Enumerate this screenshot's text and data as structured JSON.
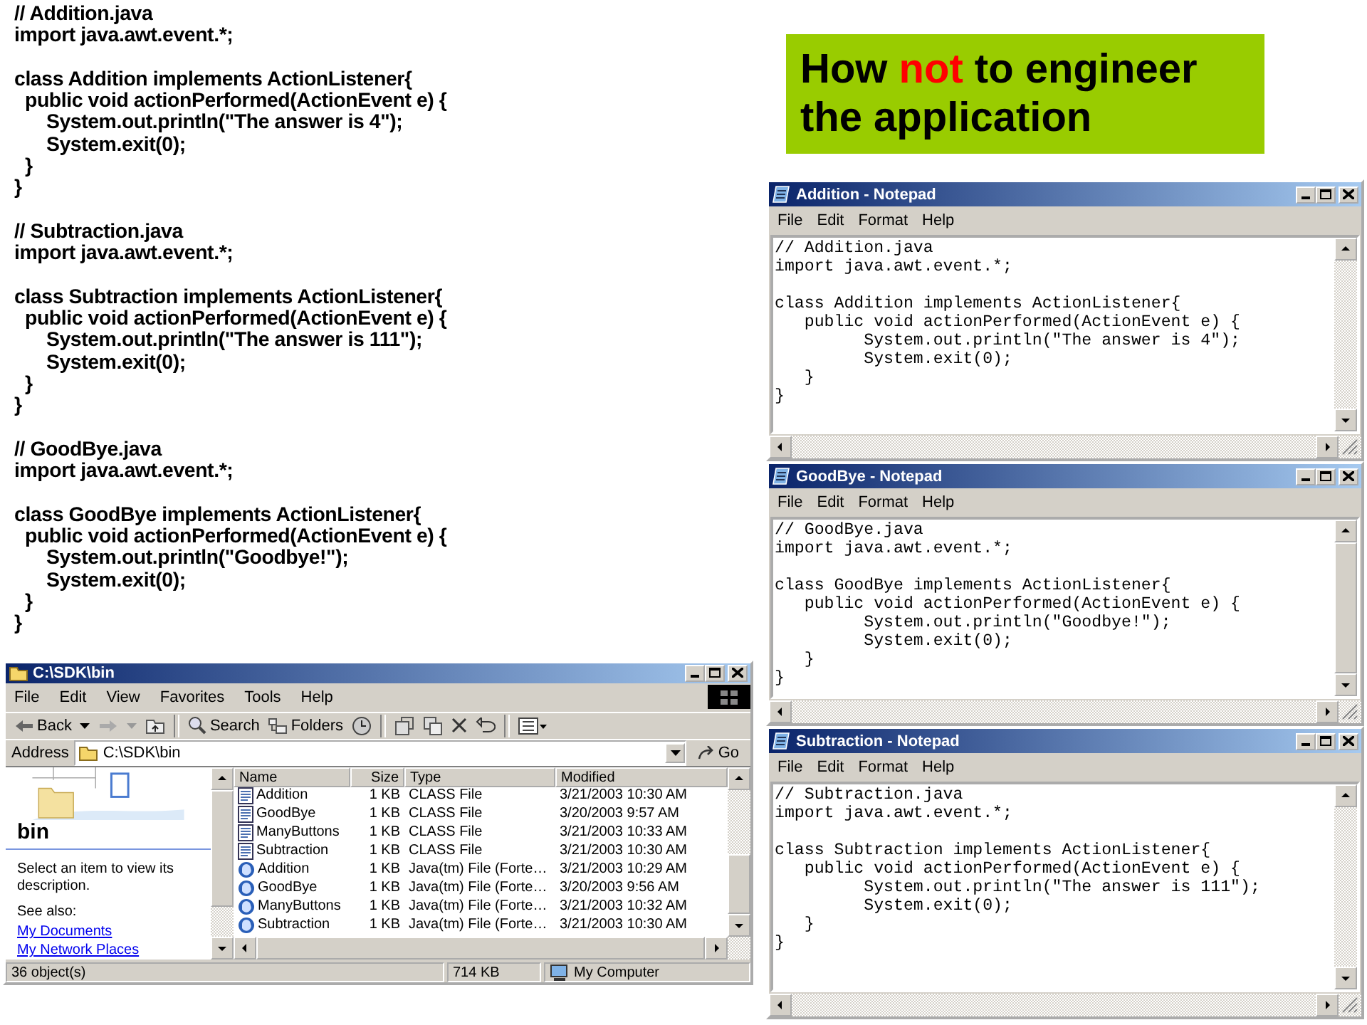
{
  "code_listing": {
    "files": [
      {
        "blocks": [
          [
            "// Addition.java",
            "import java.awt.event.*;"
          ],
          [
            "class Addition implements ActionListener{",
            "  public void actionPerformed(ActionEvent e) {",
            "      System.out.println(\"The answer is 4\");",
            "      System.exit(0);",
            "  }",
            "}"
          ]
        ]
      },
      {
        "blocks": [
          [
            "// Subtraction.java",
            "import java.awt.event.*;"
          ],
          [
            "class Subtraction implements ActionListener{",
            "  public void actionPerformed(ActionEvent e) {",
            "      System.out.println(\"The answer is 111\");",
            "      System.exit(0);",
            "  }",
            "}"
          ]
        ]
      },
      {
        "blocks": [
          [
            "// GoodBye.java",
            "import java.awt.event.*;"
          ],
          [
            "class GoodBye implements ActionListener{",
            "  public void actionPerformed(ActionEvent e) {",
            "      System.out.println(\"Goodbye!\");",
            "      System.exit(0);",
            "  }",
            "}"
          ]
        ]
      }
    ]
  },
  "headline": {
    "parts": [
      {
        "text": "How ",
        "emphasis": false
      },
      {
        "text": "not",
        "emphasis": true
      },
      {
        "text": " to engineer the application",
        "emphasis": false
      }
    ]
  },
  "explorer": {
    "title": "C:\\SDK\\bin",
    "menu": [
      "File",
      "Edit",
      "View",
      "Favorites",
      "Tools",
      "Help"
    ],
    "toolbar": {
      "back": "Back",
      "search": "Search",
      "folders": "Folders"
    },
    "address": {
      "label": "Address",
      "value": "C:\\SDK\\bin",
      "go": "Go"
    },
    "side_panel": {
      "folder": "bin",
      "description": "Select an item to view its description.",
      "see_also": "See also:",
      "links": [
        "My Documents",
        "My Network Places"
      ]
    },
    "columns": [
      "Name",
      "Size",
      "Type",
      "Modified"
    ],
    "rows": [
      {
        "kind": "class",
        "name": "Addition",
        "size": "1 KB",
        "type": "CLASS File",
        "modified": "3/21/2003 10:30 AM"
      },
      {
        "kind": "class",
        "name": "GoodBye",
        "size": "1 KB",
        "type": "CLASS File",
        "modified": "3/20/2003 9:57 AM"
      },
      {
        "kind": "class",
        "name": "ManyButtons",
        "size": "1 KB",
        "type": "CLASS File",
        "modified": "3/21/2003 10:33 AM"
      },
      {
        "kind": "class",
        "name": "Subtraction",
        "size": "1 KB",
        "type": "CLASS File",
        "modified": "3/21/2003 10:30 AM"
      },
      {
        "kind": "java",
        "name": "Addition",
        "size": "1 KB",
        "type": "Java(tm) File (Forte…",
        "modified": "3/21/2003 10:29 AM"
      },
      {
        "kind": "java",
        "name": "GoodBye",
        "size": "1 KB",
        "type": "Java(tm) File (Forte…",
        "modified": "3/20/2003 9:56 AM"
      },
      {
        "kind": "java",
        "name": "ManyButtons",
        "size": "1 KB",
        "type": "Java(tm) File (Forte…",
        "modified": "3/21/2003 10:32 AM"
      },
      {
        "kind": "java",
        "name": "Subtraction",
        "size": "1 KB",
        "type": "Java(tm) File (Forte…",
        "modified": "3/21/2003 10:30 AM"
      }
    ],
    "status_bar": {
      "objects": "36 object(s)",
      "size": "714 KB",
      "zone": "My Computer"
    }
  },
  "notepads": [
    {
      "title": "Addition - Notepad",
      "menu": [
        "File",
        "Edit",
        "Format",
        "Help"
      ],
      "blocks": [
        [
          "// Addition.java",
          "import java.awt.event.*;"
        ],
        [
          "class Addition implements ActionListener{",
          "   public void actionPerformed(ActionEvent e) {",
          "         System.out.println(\"The answer is 4\");",
          "         System.exit(0);",
          "   }",
          "}"
        ]
      ]
    },
    {
      "title": "GoodBye - Notepad",
      "menu": [
        "File",
        "Edit",
        "Format",
        "Help"
      ],
      "blocks": [
        [
          "// GoodBye.java",
          "import java.awt.event.*;"
        ],
        [
          "class GoodBye implements ActionListener{",
          "   public void actionPerformed(ActionEvent e) {",
          "         System.out.println(\"Goodbye!\");",
          "         System.exit(0);",
          "   }",
          "}"
        ]
      ]
    },
    {
      "title": "Subtraction - Notepad",
      "menu": [
        "File",
        "Edit",
        "Format",
        "Help"
      ],
      "blocks": [
        [
          "// Subtraction.java",
          "import java.awt.event.*;"
        ],
        [
          "class Subtraction implements ActionListener{",
          "   public void actionPerformed(ActionEvent e) {",
          "         System.out.println(\"The answer is 111\");",
          "         System.exit(0);",
          "   }",
          "}"
        ]
      ]
    }
  ]
}
